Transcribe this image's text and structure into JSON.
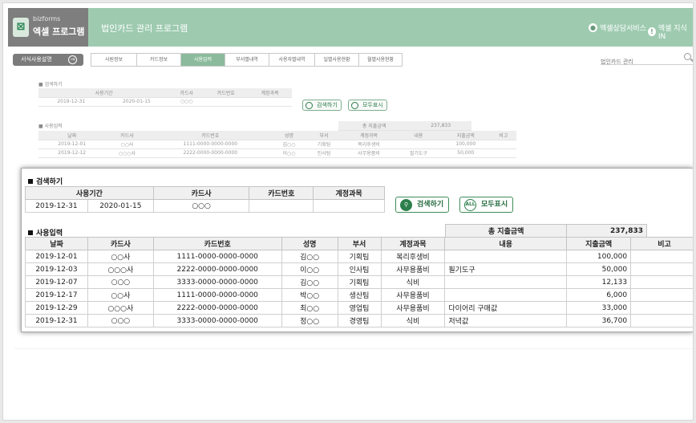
{
  "header": {
    "brand": "bizforms",
    "program_name": "엑셀 프로그램",
    "app_title": "법인카드 관리 프로그램",
    "consult_label": "엑셀상담서비스",
    "knowledge_label": "엑셀 지식 IN"
  },
  "toolbar": {
    "manual_label": "서식사용설명",
    "tabs": [
      "사원정보",
      "카드정보",
      "사용입력",
      "부서별내역",
      "사용자별내역",
      "일별사용현황",
      "월별사용현황"
    ],
    "active_tab": "사용입력",
    "search_placeholder": "법인카드 관리"
  },
  "search_section": {
    "title": "검색하기",
    "headers": [
      "사용기간",
      "카드사",
      "카드번호",
      "계정과목"
    ],
    "start_date": "2019-12-31",
    "end_date": "2020-01-15",
    "card_company": "○○○",
    "card_number": "",
    "account": "",
    "search_button": "검색하기",
    "show_all_button": "모두표시",
    "show_all_icon_text": "ALL"
  },
  "usage_section": {
    "title": "사용입력",
    "total_label": "총 지출금액",
    "total_value": "237,833",
    "headers": [
      "날짜",
      "카드사",
      "카드번호",
      "성명",
      "부서",
      "계정과목",
      "내용",
      "지출금액",
      "비고"
    ],
    "rows": [
      [
        "2019-12-01",
        "○○사",
        "1111-0000-0000-0000",
        "김○○",
        "기획팀",
        "복리후생비",
        "",
        "100,000",
        ""
      ],
      [
        "2019-12-03",
        "○○○사",
        "2222-0000-0000-0000",
        "이○○",
        "인사팀",
        "사무용품비",
        "필기도구",
        "50,000",
        ""
      ],
      [
        "2019-12-07",
        "○○○",
        "3333-0000-0000-0000",
        "김○○",
        "기획팀",
        "식비",
        "",
        "12,133",
        ""
      ],
      [
        "2019-12-17",
        "○○사",
        "1111-0000-0000-0000",
        "박○○",
        "생산팀",
        "사무용품비",
        "",
        "6,000",
        ""
      ],
      [
        "2019-12-29",
        "○○○사",
        "2222-0000-0000-0000",
        "최○○",
        "영업팀",
        "사무용품비",
        "다이어리 구매값",
        "33,000",
        ""
      ],
      [
        "2019-12-31",
        "○○○",
        "3333-0000-0000-0000",
        "정○○",
        "경영팀",
        "식비",
        "저녁값",
        "36,700",
        ""
      ]
    ],
    "bg_rows": [
      [
        "2019-12-01",
        "○○사",
        "1111-0000-0000-0000",
        "김○○",
        "기획팀",
        "복리후생비",
        "",
        "100,000",
        ""
      ],
      [
        "2019-12-12",
        "○○○사",
        "2222-0000-0000-0000",
        "이○○",
        "인사팀",
        "사무용품비",
        "필기도구",
        "50,000",
        ""
      ]
    ]
  },
  "colors": {
    "header_bg": "#9ecbb0",
    "logo_bg": "#7e7e7e",
    "active_tab": "#8bbb9c",
    "button_green": "#2c7f4c"
  }
}
